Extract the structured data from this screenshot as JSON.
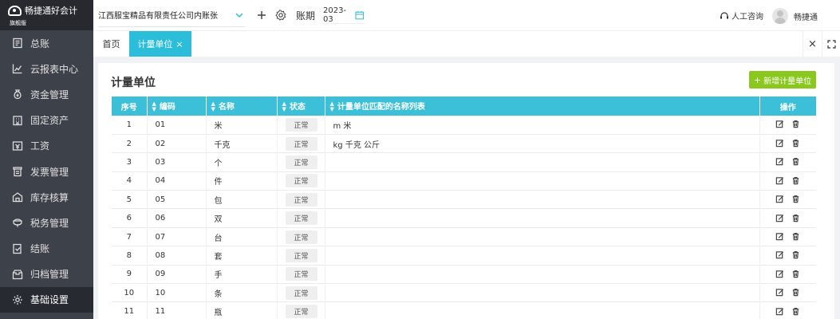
{
  "brand": {
    "name": "畅捷通好会计",
    "edition": "旗舰版"
  },
  "colors": {
    "accent": "#2bbdd9",
    "table_header": "#3cc0da",
    "add_button": "#8bc81f",
    "sidebar_bg": "#3d4149",
    "sidebar_active": "#272a31"
  },
  "sidebar": {
    "items": [
      {
        "label": "总账",
        "icon": "ledger-icon"
      },
      {
        "label": "云报表中心",
        "icon": "chart-icon"
      },
      {
        "label": "资金管理",
        "icon": "money-bag-icon"
      },
      {
        "label": "固定资产",
        "icon": "building-icon"
      },
      {
        "label": "工资",
        "icon": "salary-icon"
      },
      {
        "label": "发票管理",
        "icon": "invoice-icon"
      },
      {
        "label": "库存核算",
        "icon": "warehouse-icon"
      },
      {
        "label": "税务管理",
        "icon": "tax-icon"
      },
      {
        "label": "结账",
        "icon": "checkout-icon"
      },
      {
        "label": "归档管理",
        "icon": "archive-icon"
      },
      {
        "label": "基础设置",
        "icon": "gear-icon",
        "active": true
      }
    ]
  },
  "header": {
    "company": "江西服宝精品有限责任公司内账张",
    "period_label": "账期",
    "period": "2023-03",
    "support": "人工咨询",
    "user": "畅捷通"
  },
  "tabs": {
    "home": "首页",
    "active": "计量单位",
    "close_glyph": "×",
    "window_close": "×"
  },
  "page": {
    "title": "计量单位",
    "add_button": "新增计量单位"
  },
  "table": {
    "columns": [
      "序号",
      "编码",
      "名称",
      "状态",
      "计量单位匹配的名称列表",
      "操作"
    ],
    "rows": [
      {
        "index": "1",
        "code": "01",
        "name": "米",
        "status": "正常",
        "aliases": "m 米"
      },
      {
        "index": "2",
        "code": "02",
        "name": "千克",
        "status": "正常",
        "aliases": "kg 千克 公斤"
      },
      {
        "index": "3",
        "code": "03",
        "name": "个",
        "status": "正常",
        "aliases": ""
      },
      {
        "index": "4",
        "code": "04",
        "name": "件",
        "status": "正常",
        "aliases": ""
      },
      {
        "index": "5",
        "code": "05",
        "name": "包",
        "status": "正常",
        "aliases": ""
      },
      {
        "index": "6",
        "code": "06",
        "name": "双",
        "status": "正常",
        "aliases": ""
      },
      {
        "index": "7",
        "code": "07",
        "name": "台",
        "status": "正常",
        "aliases": ""
      },
      {
        "index": "8",
        "code": "08",
        "name": "套",
        "status": "正常",
        "aliases": ""
      },
      {
        "index": "9",
        "code": "09",
        "name": "手",
        "status": "正常",
        "aliases": ""
      },
      {
        "index": "10",
        "code": "10",
        "name": "条",
        "status": "正常",
        "aliases": ""
      },
      {
        "index": "11",
        "code": "11",
        "name": "瓶",
        "status": "正常",
        "aliases": ""
      }
    ]
  }
}
